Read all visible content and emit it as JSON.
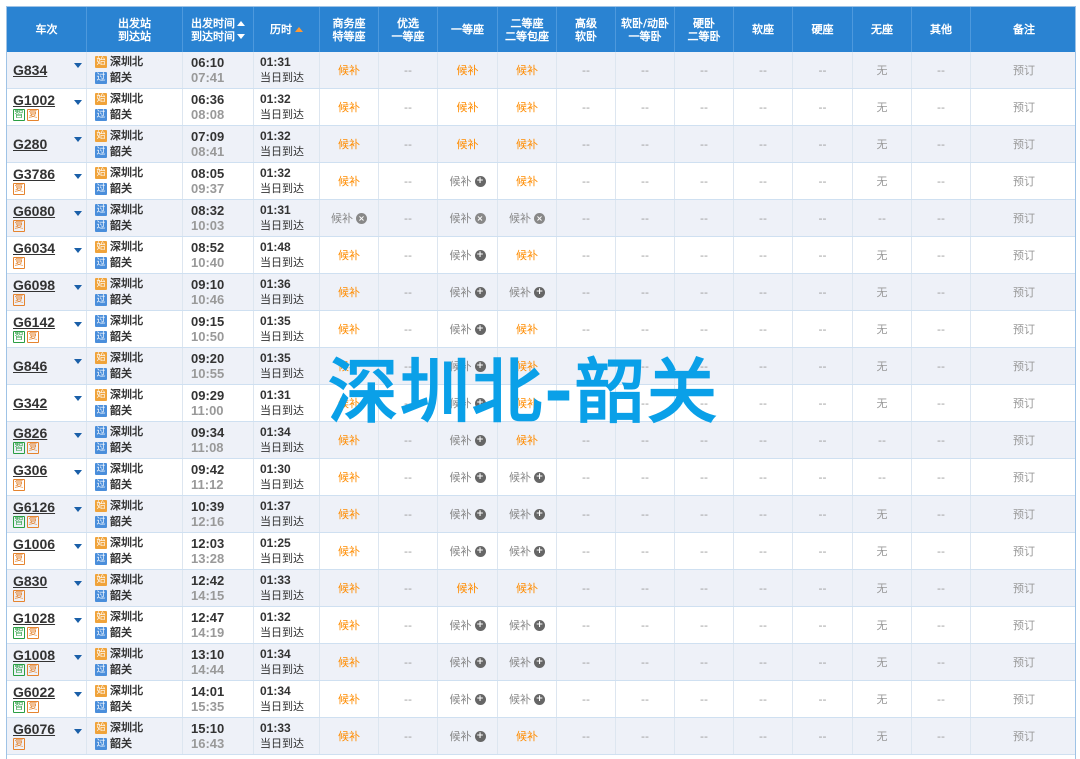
{
  "header": {
    "train": "车次",
    "station_from": "出发站",
    "station_to": "到达站",
    "time_dep": "出发时间",
    "time_arr": "到达时间",
    "duration": "历时",
    "business_1": "商务座",
    "business_2": "特等座",
    "premium_1": "优选",
    "premium_2": "一等座",
    "first": "一等座",
    "second_1": "二等座",
    "second_2": "二等包座",
    "hsoft_1": "高级",
    "hsoft_2": "软卧",
    "softsleep_1": "软卧/动卧",
    "softsleep_2": "一等卧",
    "hardsleep_1": "硬卧",
    "hardsleep_2": "二等卧",
    "softseat": "软座",
    "hardseat": "硬座",
    "noseat": "无座",
    "other": "其他",
    "remark": "备注"
  },
  "labels": {
    "same_day": "当日到达",
    "houbu": "候补",
    "dash": "--",
    "wu": "无",
    "book": "预订",
    "badge_zhi": "智",
    "badge_fu": "复",
    "badge_start": "始",
    "badge_pass": "过",
    "badge_end": "终"
  },
  "watermark": "深圳北-韶关",
  "rows": [
    {
      "train": "G834",
      "from": "深圳北",
      "to": "韶关",
      "from_type": "start",
      "dep": "06:10",
      "arr": "07:41",
      "dur": "01:31",
      "zhi": false,
      "fu": false,
      "business": "on",
      "premium": "dash",
      "first": "on",
      "second": "on",
      "noseat": "wu"
    },
    {
      "train": "G1002",
      "from": "深圳北",
      "to": "韶关",
      "from_type": "start",
      "dep": "06:36",
      "arr": "08:08",
      "dur": "01:32",
      "zhi": true,
      "fu": true,
      "business": "on",
      "premium": "dash",
      "first": "on",
      "second": "on",
      "noseat": "wu"
    },
    {
      "train": "G280",
      "from": "深圳北",
      "to": "韶关",
      "from_type": "start",
      "dep": "07:09",
      "arr": "08:41",
      "dur": "01:32",
      "zhi": false,
      "fu": false,
      "business": "on",
      "premium": "dash",
      "first": "on",
      "second": "on",
      "noseat": "wu"
    },
    {
      "train": "G3786",
      "from": "深圳北",
      "to": "韶关",
      "from_type": "start",
      "dep": "08:05",
      "arr": "09:37",
      "dur": "01:32",
      "zhi": false,
      "fu": true,
      "business": "on",
      "premium": "dash",
      "first": "plus",
      "second": "on",
      "noseat": "wu"
    },
    {
      "train": "G6080",
      "from": "深圳北",
      "to": "韶关",
      "from_type": "pass",
      "dep": "08:32",
      "arr": "10:03",
      "dur": "01:31",
      "zhi": false,
      "fu": true,
      "business": "x",
      "premium": "dash",
      "first": "x",
      "second": "x",
      "noseat": "dash"
    },
    {
      "train": "G6034",
      "from": "深圳北",
      "to": "韶关",
      "from_type": "start",
      "dep": "08:52",
      "arr": "10:40",
      "dur": "01:48",
      "zhi": false,
      "fu": true,
      "business": "on",
      "premium": "dash",
      "first": "plus",
      "second": "on",
      "noseat": "wu"
    },
    {
      "train": "G6098",
      "from": "深圳北",
      "to": "韶关",
      "from_type": "start",
      "dep": "09:10",
      "arr": "10:46",
      "dur": "01:36",
      "zhi": false,
      "fu": true,
      "business": "on",
      "premium": "dash",
      "first": "plus",
      "second": "plus",
      "noseat": "wu"
    },
    {
      "train": "G6142",
      "from": "深圳北",
      "to": "韶关",
      "from_type": "pass",
      "dep": "09:15",
      "arr": "10:50",
      "dur": "01:35",
      "zhi": true,
      "fu": true,
      "business": "on",
      "premium": "dash",
      "first": "plus",
      "second": "on",
      "noseat": "wu"
    },
    {
      "train": "G846",
      "from": "深圳北",
      "to": "韶关",
      "from_type": "start",
      "dep": "09:20",
      "arr": "10:55",
      "dur": "01:35",
      "zhi": false,
      "fu": false,
      "business": "on",
      "premium": "dash",
      "first": "plus",
      "second": "on",
      "noseat": "wu"
    },
    {
      "train": "G342",
      "from": "深圳北",
      "to": "韶关",
      "from_type": "start",
      "dep": "09:29",
      "arr": "11:00",
      "dur": "01:31",
      "zhi": false,
      "fu": false,
      "business": "on",
      "premium": "dash",
      "first": "plus",
      "second": "on",
      "noseat": "wu"
    },
    {
      "train": "G826",
      "from": "深圳北",
      "to": "韶关",
      "from_type": "pass",
      "dep": "09:34",
      "arr": "11:08",
      "dur": "01:34",
      "zhi": true,
      "fu": true,
      "business": "on",
      "premium": "dash",
      "first": "plus",
      "second": "on",
      "noseat": "dash"
    },
    {
      "train": "G306",
      "from": "深圳北",
      "to": "韶关",
      "from_type": "pass",
      "dep": "09:42",
      "arr": "11:12",
      "dur": "01:30",
      "zhi": false,
      "fu": true,
      "business": "on",
      "premium": "dash",
      "first": "plus",
      "second": "plus",
      "noseat": "dash"
    },
    {
      "train": "G6126",
      "from": "深圳北",
      "to": "韶关",
      "from_type": "start",
      "dep": "10:39",
      "arr": "12:16",
      "dur": "01:37",
      "zhi": true,
      "fu": true,
      "business": "on",
      "premium": "dash",
      "first": "plus",
      "second": "plus",
      "noseat": "wu"
    },
    {
      "train": "G1006",
      "from": "深圳北",
      "to": "韶关",
      "from_type": "start",
      "dep": "12:03",
      "arr": "13:28",
      "dur": "01:25",
      "zhi": false,
      "fu": true,
      "business": "on",
      "premium": "dash",
      "first": "plus",
      "second": "plus",
      "noseat": "wu"
    },
    {
      "train": "G830",
      "from": "深圳北",
      "to": "韶关",
      "from_type": "start",
      "dep": "12:42",
      "arr": "14:15",
      "dur": "01:33",
      "zhi": false,
      "fu": true,
      "business": "on",
      "premium": "dash",
      "first": "on",
      "second": "on",
      "noseat": "wu"
    },
    {
      "train": "G1028",
      "from": "深圳北",
      "to": "韶关",
      "from_type": "start",
      "dep": "12:47",
      "arr": "14:19",
      "dur": "01:32",
      "zhi": true,
      "fu": true,
      "business": "on",
      "premium": "dash",
      "first": "plus",
      "second": "plus",
      "noseat": "wu"
    },
    {
      "train": "G1008",
      "from": "深圳北",
      "to": "韶关",
      "from_type": "start",
      "dep": "13:10",
      "arr": "14:44",
      "dur": "01:34",
      "zhi": true,
      "fu": true,
      "business": "on",
      "premium": "dash",
      "first": "plus",
      "second": "plus",
      "noseat": "wu"
    },
    {
      "train": "G6022",
      "from": "深圳北",
      "to": "韶关",
      "from_type": "start",
      "dep": "14:01",
      "arr": "15:35",
      "dur": "01:34",
      "zhi": true,
      "fu": true,
      "business": "on",
      "premium": "dash",
      "first": "plus",
      "second": "plus",
      "noseat": "wu"
    },
    {
      "train": "G6076",
      "from": "深圳北",
      "to": "韶关",
      "from_type": "start",
      "dep": "15:10",
      "arr": "16:43",
      "dur": "01:33",
      "zhi": false,
      "fu": true,
      "business": "on",
      "premium": "dash",
      "first": "plus",
      "second": "on",
      "noseat": "wu"
    }
  ]
}
